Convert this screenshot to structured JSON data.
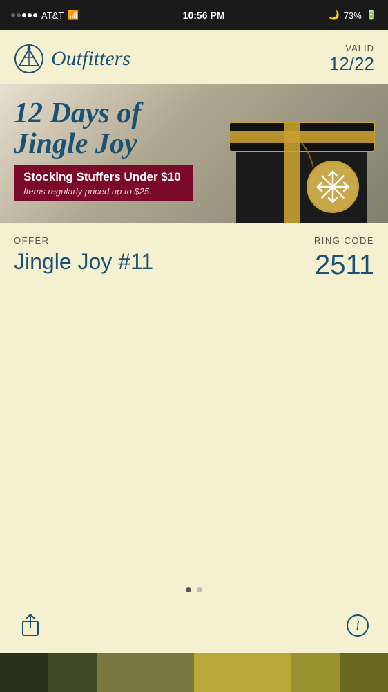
{
  "status_bar": {
    "carrier": "AT&T",
    "time": "10:56 PM",
    "battery": "73%",
    "wifi": true
  },
  "header": {
    "logo_text": "Outfitters",
    "valid_label": "VALID",
    "valid_date": "12/22"
  },
  "banner": {
    "title_line1": "12 Days of",
    "title_line2": "Jingle Joy",
    "stocking_title": "Stocking Stuffers Under $10",
    "stocking_subtitle": "Items regularly priced up to $25."
  },
  "offer": {
    "offer_label": "OFFER",
    "offer_value": "Jingle Joy #11",
    "ring_code_label": "RING CODE",
    "ring_code_value": "2511"
  },
  "pagination": {
    "active_index": 0,
    "total": 2
  },
  "toolbar": {
    "share_icon": "share",
    "info_icon": "info"
  }
}
